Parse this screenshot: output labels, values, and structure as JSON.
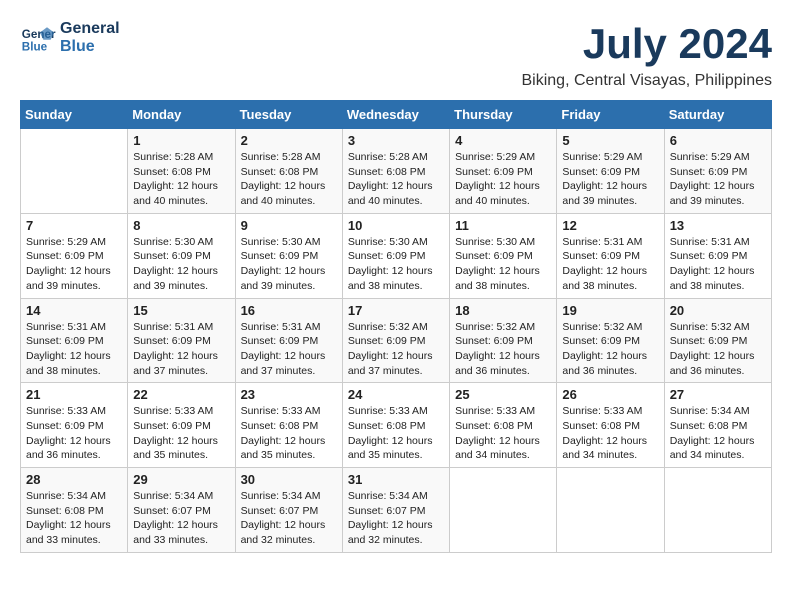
{
  "logo": {
    "line1": "General",
    "line2": "Blue"
  },
  "title": "July 2024",
  "location": "Biking, Central Visayas, Philippines",
  "headers": [
    "Sunday",
    "Monday",
    "Tuesday",
    "Wednesday",
    "Thursday",
    "Friday",
    "Saturday"
  ],
  "weeks": [
    [
      {
        "day": "",
        "info": ""
      },
      {
        "day": "1",
        "info": "Sunrise: 5:28 AM\nSunset: 6:08 PM\nDaylight: 12 hours\nand 40 minutes."
      },
      {
        "day": "2",
        "info": "Sunrise: 5:28 AM\nSunset: 6:08 PM\nDaylight: 12 hours\nand 40 minutes."
      },
      {
        "day": "3",
        "info": "Sunrise: 5:28 AM\nSunset: 6:08 PM\nDaylight: 12 hours\nand 40 minutes."
      },
      {
        "day": "4",
        "info": "Sunrise: 5:29 AM\nSunset: 6:09 PM\nDaylight: 12 hours\nand 40 minutes."
      },
      {
        "day": "5",
        "info": "Sunrise: 5:29 AM\nSunset: 6:09 PM\nDaylight: 12 hours\nand 39 minutes."
      },
      {
        "day": "6",
        "info": "Sunrise: 5:29 AM\nSunset: 6:09 PM\nDaylight: 12 hours\nand 39 minutes."
      }
    ],
    [
      {
        "day": "7",
        "info": "Sunrise: 5:29 AM\nSunset: 6:09 PM\nDaylight: 12 hours\nand 39 minutes."
      },
      {
        "day": "8",
        "info": "Sunrise: 5:30 AM\nSunset: 6:09 PM\nDaylight: 12 hours\nand 39 minutes."
      },
      {
        "day": "9",
        "info": "Sunrise: 5:30 AM\nSunset: 6:09 PM\nDaylight: 12 hours\nand 39 minutes."
      },
      {
        "day": "10",
        "info": "Sunrise: 5:30 AM\nSunset: 6:09 PM\nDaylight: 12 hours\nand 38 minutes."
      },
      {
        "day": "11",
        "info": "Sunrise: 5:30 AM\nSunset: 6:09 PM\nDaylight: 12 hours\nand 38 minutes."
      },
      {
        "day": "12",
        "info": "Sunrise: 5:31 AM\nSunset: 6:09 PM\nDaylight: 12 hours\nand 38 minutes."
      },
      {
        "day": "13",
        "info": "Sunrise: 5:31 AM\nSunset: 6:09 PM\nDaylight: 12 hours\nand 38 minutes."
      }
    ],
    [
      {
        "day": "14",
        "info": "Sunrise: 5:31 AM\nSunset: 6:09 PM\nDaylight: 12 hours\nand 38 minutes."
      },
      {
        "day": "15",
        "info": "Sunrise: 5:31 AM\nSunset: 6:09 PM\nDaylight: 12 hours\nand 37 minutes."
      },
      {
        "day": "16",
        "info": "Sunrise: 5:31 AM\nSunset: 6:09 PM\nDaylight: 12 hours\nand 37 minutes."
      },
      {
        "day": "17",
        "info": "Sunrise: 5:32 AM\nSunset: 6:09 PM\nDaylight: 12 hours\nand 37 minutes."
      },
      {
        "day": "18",
        "info": "Sunrise: 5:32 AM\nSunset: 6:09 PM\nDaylight: 12 hours\nand 36 minutes."
      },
      {
        "day": "19",
        "info": "Sunrise: 5:32 AM\nSunset: 6:09 PM\nDaylight: 12 hours\nand 36 minutes."
      },
      {
        "day": "20",
        "info": "Sunrise: 5:32 AM\nSunset: 6:09 PM\nDaylight: 12 hours\nand 36 minutes."
      }
    ],
    [
      {
        "day": "21",
        "info": "Sunrise: 5:33 AM\nSunset: 6:09 PM\nDaylight: 12 hours\nand 36 minutes."
      },
      {
        "day": "22",
        "info": "Sunrise: 5:33 AM\nSunset: 6:09 PM\nDaylight: 12 hours\nand 35 minutes."
      },
      {
        "day": "23",
        "info": "Sunrise: 5:33 AM\nSunset: 6:08 PM\nDaylight: 12 hours\nand 35 minutes."
      },
      {
        "day": "24",
        "info": "Sunrise: 5:33 AM\nSunset: 6:08 PM\nDaylight: 12 hours\nand 35 minutes."
      },
      {
        "day": "25",
        "info": "Sunrise: 5:33 AM\nSunset: 6:08 PM\nDaylight: 12 hours\nand 34 minutes."
      },
      {
        "day": "26",
        "info": "Sunrise: 5:33 AM\nSunset: 6:08 PM\nDaylight: 12 hours\nand 34 minutes."
      },
      {
        "day": "27",
        "info": "Sunrise: 5:34 AM\nSunset: 6:08 PM\nDaylight: 12 hours\nand 34 minutes."
      }
    ],
    [
      {
        "day": "28",
        "info": "Sunrise: 5:34 AM\nSunset: 6:08 PM\nDaylight: 12 hours\nand 33 minutes."
      },
      {
        "day": "29",
        "info": "Sunrise: 5:34 AM\nSunset: 6:07 PM\nDaylight: 12 hours\nand 33 minutes."
      },
      {
        "day": "30",
        "info": "Sunrise: 5:34 AM\nSunset: 6:07 PM\nDaylight: 12 hours\nand 32 minutes."
      },
      {
        "day": "31",
        "info": "Sunrise: 5:34 AM\nSunset: 6:07 PM\nDaylight: 12 hours\nand 32 minutes."
      },
      {
        "day": "",
        "info": ""
      },
      {
        "day": "",
        "info": ""
      },
      {
        "day": "",
        "info": ""
      }
    ]
  ]
}
